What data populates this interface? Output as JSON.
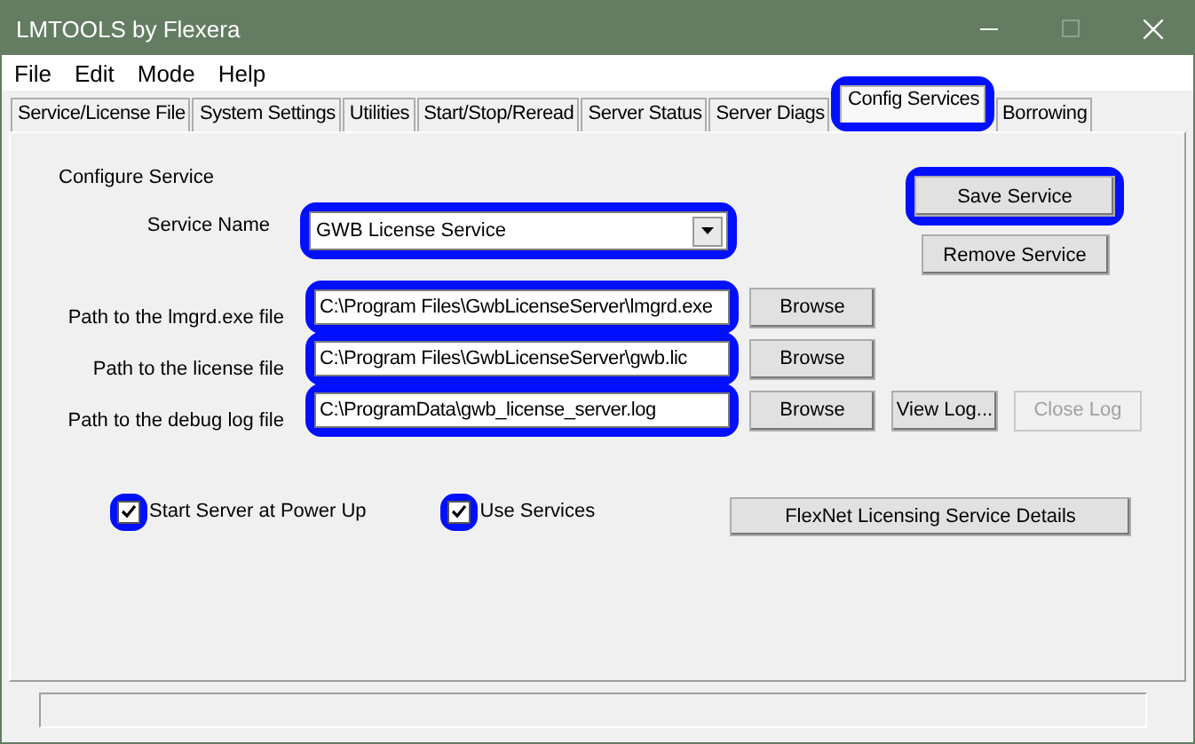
{
  "window": {
    "title": "LMTOOLS by Flexera"
  },
  "menu": [
    "File",
    "Edit",
    "Mode",
    "Help"
  ],
  "tabs": [
    {
      "label": "Service/License File",
      "selected": false,
      "highlighted": false
    },
    {
      "label": "System Settings",
      "selected": false,
      "highlighted": false
    },
    {
      "label": "Utilities",
      "selected": false,
      "highlighted": false
    },
    {
      "label": "Start/Stop/Reread",
      "selected": false,
      "highlighted": false
    },
    {
      "label": "Server Status",
      "selected": false,
      "highlighted": false
    },
    {
      "label": "Server Diags",
      "selected": false,
      "highlighted": false
    },
    {
      "label": "Config Services",
      "selected": true,
      "highlighted": true
    },
    {
      "label": "Borrowing",
      "selected": false,
      "highlighted": false
    }
  ],
  "config": {
    "heading": "Configure Service",
    "service_name": {
      "label": "Service Name",
      "value": "GWB License Service",
      "highlighted": true
    },
    "save_button": {
      "label": "Save Service",
      "highlighted": true
    },
    "remove_button": {
      "label": "Remove Service",
      "highlighted": false
    },
    "paths": [
      {
        "label": "Path to the lmgrd.exe file",
        "value": "C:\\Program Files\\GwbLicenseServer\\lmgrd.exe",
        "highlighted": true,
        "buttons": [
          {
            "label": "Browse",
            "disabled": false
          }
        ]
      },
      {
        "label": "Path to the license file",
        "value": "C:\\Program Files\\GwbLicenseServer\\gwb.lic",
        "highlighted": true,
        "buttons": [
          {
            "label": "Browse",
            "disabled": false
          }
        ]
      },
      {
        "label": "Path to the debug log file",
        "value": "C:\\ProgramData\\gwb_license_server.log",
        "highlighted": true,
        "buttons": [
          {
            "label": "Browse",
            "disabled": false
          },
          {
            "label": "View Log...",
            "disabled": false
          },
          {
            "label": "Close Log",
            "disabled": true
          }
        ]
      }
    ],
    "checkboxes": [
      {
        "label": "Start Server at Power Up",
        "checked": true,
        "highlighted": true
      },
      {
        "label": "Use Services",
        "checked": true,
        "highlighted": true
      }
    ],
    "details_button": {
      "label": "FlexNet Licensing Service Details"
    }
  }
}
